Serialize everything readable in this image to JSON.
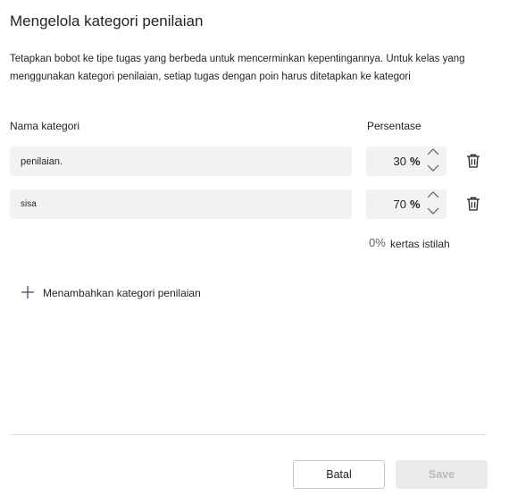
{
  "dialog": {
    "title": "Mengelola kategori penilaian",
    "description": "Tetapkan bobot ke tipe tugas yang berbeda untuk mencerminkan kepentingannya. Untuk kelas yang menggunakan kategori penilaian, setiap tugas dengan poin harus ditetapkan ke kategori"
  },
  "columns": {
    "name": "Nama kategori",
    "percent": "Persentase"
  },
  "categories": [
    {
      "name": "penilaian.",
      "percent": "30",
      "unit": "%"
    },
    {
      "name": "sisa",
      "percent": "70",
      "unit": "%"
    }
  ],
  "total": {
    "value": "0%",
    "label": "kertas istilah"
  },
  "add_category": {
    "label": "Menambahkan kategori penilaian"
  },
  "buttons": {
    "cancel": "Batal",
    "save": "Save"
  },
  "icons": {
    "spin_up": "chevron-up-icon",
    "spin_down": "chevron-down-icon",
    "delete": "trash-icon",
    "add": "plus-icon"
  },
  "colors": {
    "field_bg": "#f3f2f1",
    "divider": "#e1dfdd",
    "save_disabled_bg": "#edebe9",
    "save_disabled_text": "#bdbbb8",
    "text": "#252423"
  }
}
